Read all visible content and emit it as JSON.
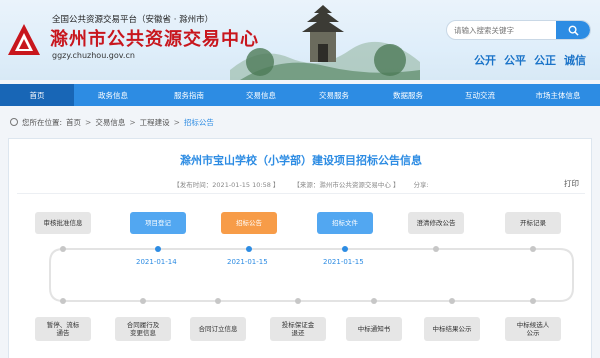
{
  "header": {
    "platform_line": "全国公共资源交易平台（安徽省 · 滁州市）",
    "site_name": "滁州市公共资源交易中心",
    "domain": "ggzy.chuzhou.gov.cn",
    "search": {
      "placeholder": "请输入搜索关键字",
      "icon": "search-icon"
    },
    "slogan": [
      "公开",
      "公平",
      "公正",
      "诚信"
    ],
    "colors": {
      "brand_red": "#c8161d",
      "accent_blue": "#2d8ce3"
    }
  },
  "nav": {
    "items": [
      "首页",
      "政务信息",
      "服务指南",
      "交易信息",
      "交易服务",
      "数据服务",
      "互动交流",
      "市场主体信息"
    ],
    "active": "首页"
  },
  "breadcrumb": {
    "prefix": "您所在位置:",
    "items": [
      "首页",
      "交易信息",
      "工程建设",
      "招标公告"
    ],
    "sep": ">"
  },
  "article": {
    "title": "滁州市宝山学校（小学部）建设项目招标公告信息",
    "publish_time": "【发布时间：2021-01-15 10:58 】",
    "source": "【来源：滁州市公共资源交易中心 】",
    "share": "分享:",
    "print": "打印"
  },
  "flow": {
    "top_steps": [
      "审核批准信息",
      "项目登记",
      "招标公告",
      "招标文件",
      "澄清修改公告",
      "开标记录"
    ],
    "top_states": [
      "inactive",
      "done",
      "current",
      "done",
      "inactive",
      "inactive"
    ],
    "dates": [
      "2021-01-14",
      "2021-01-15",
      "2021-01-15"
    ],
    "bottom_steps": [
      [
        "暂停、流标",
        "通告"
      ],
      [
        "合同履行及",
        "变更信息"
      ],
      [
        "合同订立信息"
      ],
      [
        "投标保证金",
        "退还"
      ],
      [
        "中标通知书"
      ],
      [
        "中标结果公示"
      ],
      [
        "中标候选人",
        "公示"
      ]
    ],
    "colors": {
      "done": "#52a7f1",
      "current": "#f79c48",
      "inactive": "#e6e6e6"
    }
  }
}
